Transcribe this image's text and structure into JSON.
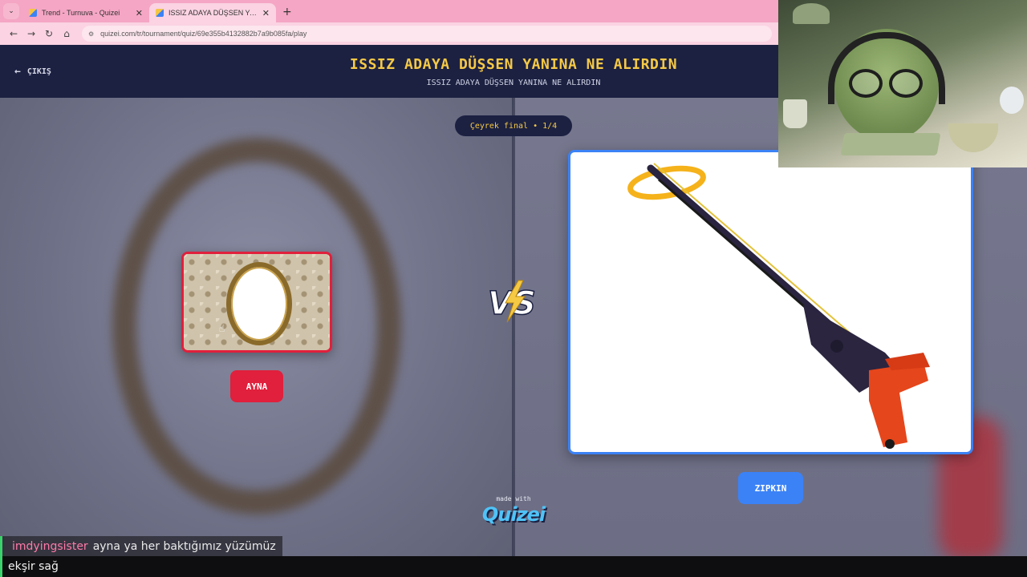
{
  "browser": {
    "tabs": [
      {
        "title": "Trend - Turnuva - Quizei",
        "active": false
      },
      {
        "title": "ISSIZ ADAYA DÜŞSEN YANINA NE ALIRDIN",
        "active": true
      }
    ],
    "url": "quizei.com/tr/tournament/quiz/69e355b4132882b7a9b085fa/play"
  },
  "header": {
    "exit_label": "ÇIKIŞ",
    "title": "ISSIZ ADAYA DÜŞSEN YANINA NE ALIRDIN",
    "subtitle": "ISSIZ ADAYA DÜŞSEN YANINA NE ALIRDIN"
  },
  "match": {
    "round_label": "Çeyrek final • 1/4",
    "left_option": {
      "label": "AYNA",
      "accent": "#e0203c"
    },
    "right_option": {
      "label": "ZIPKIN",
      "accent": "#3b82f6"
    },
    "vs_icon": "vs-lightning-icon"
  },
  "branding": {
    "made_with": "made with",
    "logo_text": "Quizei"
  },
  "chat": {
    "messages": [
      {
        "user": "imdyingsister",
        "text": "ayna ya her baktığımız yüzümüz"
      },
      {
        "user": "",
        "text": "ekşir sağ"
      }
    ]
  },
  "colors": {
    "header_bg": "#1c2142",
    "title_yellow": "#f6c945",
    "tabbar_pink": "#f5a6c4"
  }
}
